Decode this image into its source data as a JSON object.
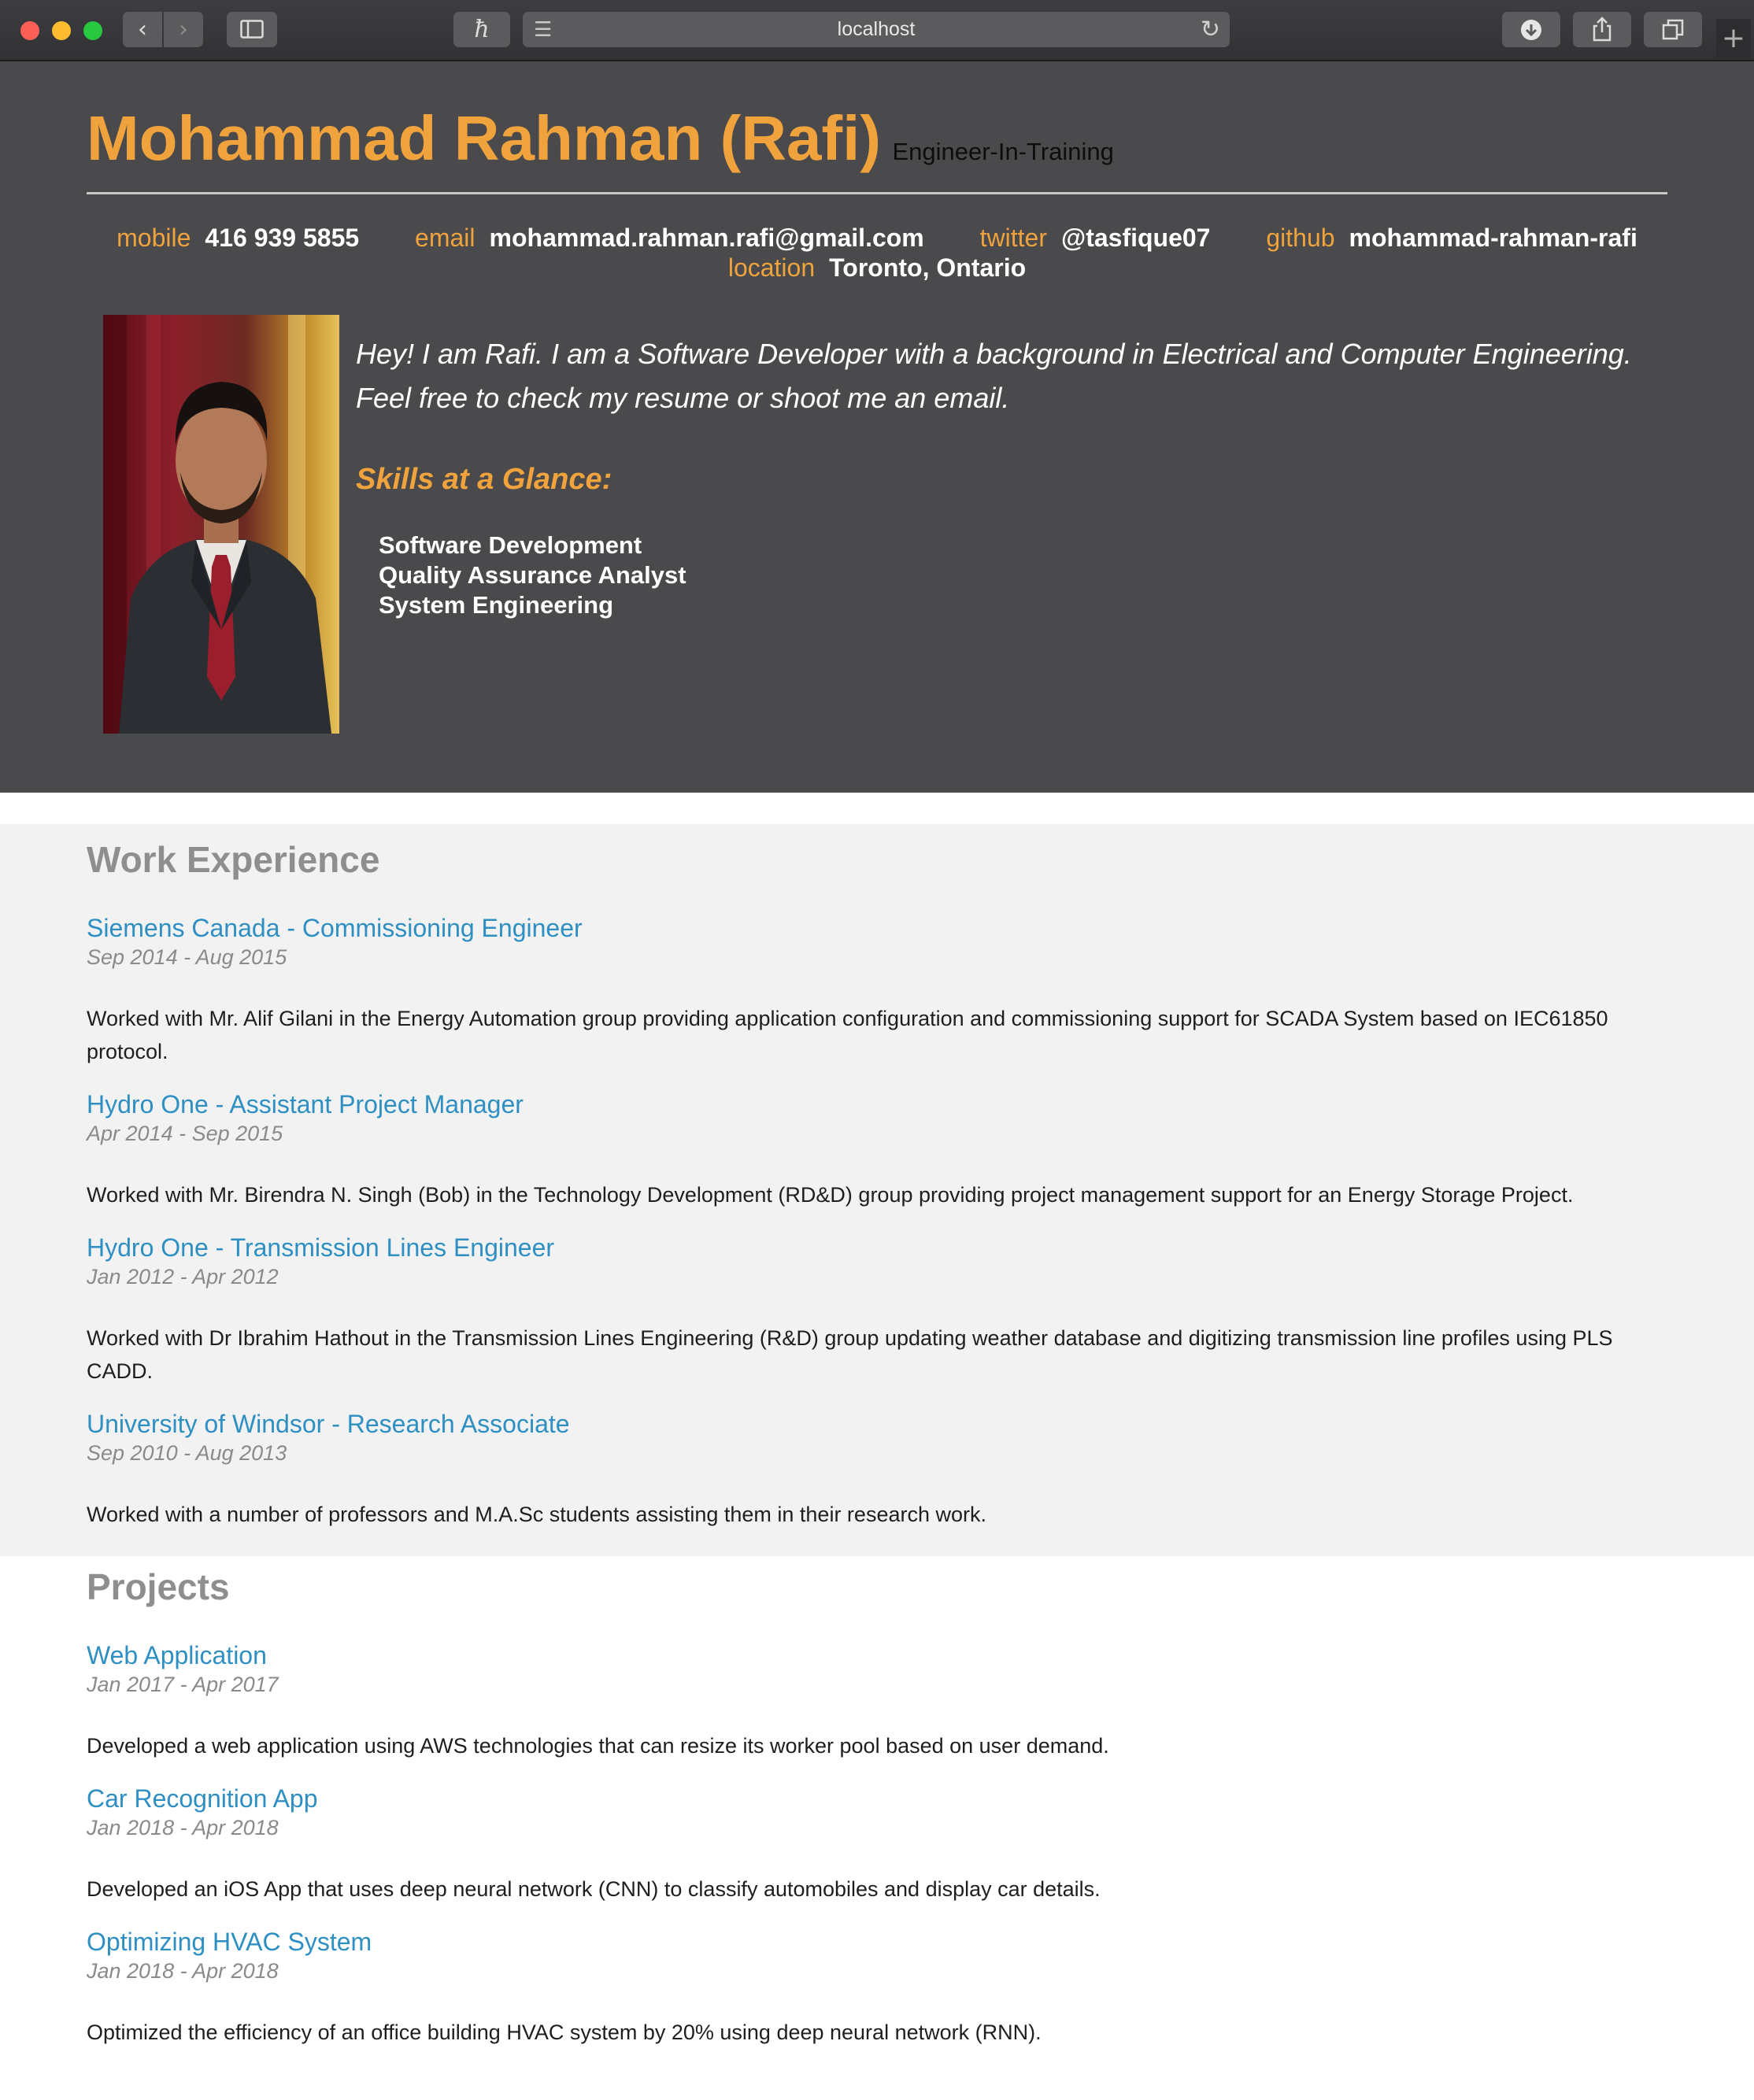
{
  "browser": {
    "url": "localhost"
  },
  "header": {
    "name": "Mohammad Rahman (Rafi)",
    "role": "Engineer-In-Training",
    "contacts": [
      {
        "label": "mobile",
        "value": "416 939 5855"
      },
      {
        "label": "email",
        "value": "mohammad.rahman.rafi@gmail.com"
      },
      {
        "label": "twitter",
        "value": "@tasfique07"
      },
      {
        "label": "github",
        "value": "mohammad-rahman-rafi"
      },
      {
        "label": "location",
        "value": "Toronto, Ontario"
      }
    ],
    "intro": "Hey! I am Rafi. I am a Software Developer with a background in Electrical and Computer Engineering. Feel free to check my resume or shoot me an email.",
    "skills_title": "Skills at a Glance:",
    "skills": [
      "Software Development",
      "Quality Assurance Analyst",
      "System Engineering"
    ]
  },
  "work": {
    "title": "Work Experience",
    "entries": [
      {
        "title": "Siemens Canada - Commissioning Engineer",
        "date": "Sep 2014 - Aug 2015",
        "desc": "Worked with Mr. Alif Gilani in the Energy Automation group providing application configuration and commissioning support for SCADA System based on IEC61850 protocol."
      },
      {
        "title": "Hydro One - Assistant Project Manager",
        "date": "Apr 2014 - Sep 2015",
        "desc": "Worked with Mr. Birendra N. Singh (Bob) in the Technology Development (RD&D) group providing project management support for an Energy Storage Project."
      },
      {
        "title": "Hydro One - Transmission Lines Engineer",
        "date": "Jan 2012 - Apr 2012",
        "desc": "Worked with Dr Ibrahim Hathout in the Transmission Lines Engineering (R&D) group updating weather database and digitizing transmission line profiles using PLS CADD."
      },
      {
        "title": "University of Windsor - Research Associate",
        "date": "Sep 2010 - Aug 2013",
        "desc": "Worked with a number of professors and M.A.Sc students assisting them in their research work."
      }
    ]
  },
  "projects": {
    "title": "Projects",
    "entries": [
      {
        "title": "Web Application",
        "date": "Jan 2017 - Apr 2017",
        "desc": "Developed a web application using AWS technologies that can resize its worker pool based on user demand."
      },
      {
        "title": "Car Recognition App",
        "date": "Jan 2018 - Apr 2018",
        "desc": "Developed an iOS App that uses deep neural network (CNN) to classify automobiles and display car details."
      },
      {
        "title": "Optimizing HVAC System",
        "date": "Jan 2018 - Apr 2018",
        "desc": "Optimized the efficiency of an office building HVAC system by 20% using deep neural network (RNN)."
      }
    ]
  },
  "icons": {
    "back": "chevron-left-icon",
    "forward": "chevron-right-icon",
    "sidebar": "sidebar-icon",
    "extension": "extension-icon",
    "reader": "reader-menu-icon",
    "reload": "reload-icon",
    "download": "download-icon",
    "share": "share-icon",
    "tabs": "tabs-icon",
    "newtab": "plus-icon"
  },
  "colors": {
    "accent": "#f0a33d",
    "link": "#2e8fc2",
    "header_bg": "#4a4a4c",
    "section_alt_bg": "#f2f2f2"
  }
}
